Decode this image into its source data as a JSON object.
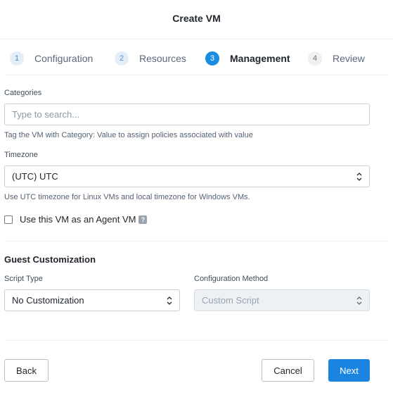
{
  "dialog": {
    "title": "Create VM"
  },
  "steps": [
    {
      "number": "1",
      "label": "Configuration"
    },
    {
      "number": "2",
      "label": "Resources"
    },
    {
      "number": "3",
      "label": "Management"
    },
    {
      "number": "4",
      "label": "Review"
    }
  ],
  "active_step": "Management",
  "categories": {
    "label": "Categories",
    "placeholder": "Type to search...",
    "help": "Tag the VM with Category: Value to assign policies associated with value"
  },
  "timezone": {
    "label": "Timezone",
    "value": "(UTC) UTC",
    "help": "Use UTC timezone for Linux VMs and local timezone for Windows VMs."
  },
  "agent_vm": {
    "label": "Use this VM as an Agent VM",
    "help_icon": "question-icon",
    "checked": false
  },
  "guest_customization": {
    "title": "Guest Customization",
    "script_type_label": "Script Type",
    "script_type_value": "No Customization",
    "config_method_label": "Configuration Method",
    "config_method_value": "Custom Script"
  },
  "footer": {
    "back": "Back",
    "cancel": "Cancel",
    "next": "Next"
  },
  "colors": {
    "primary": "#1b84e0",
    "step_active": "#1b8de0"
  }
}
